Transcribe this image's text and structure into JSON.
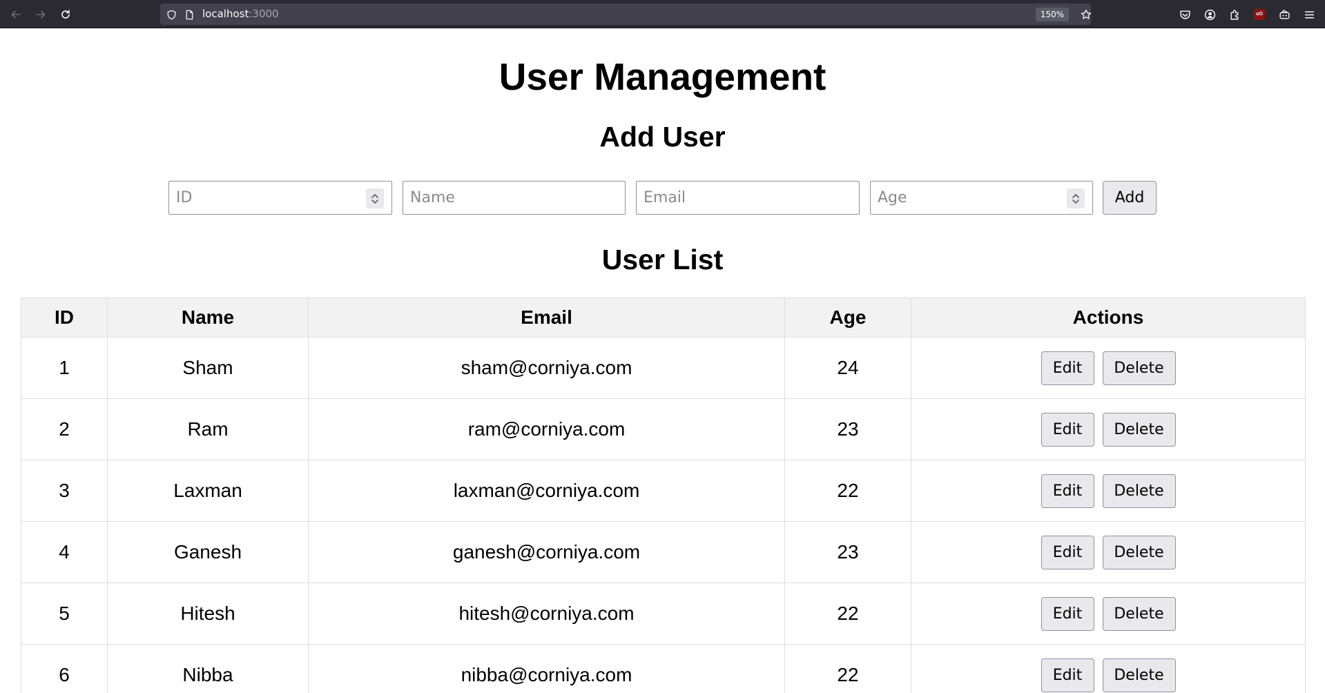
{
  "browser": {
    "url_host": "localhost",
    "url_port": ":3000",
    "zoom": "150%",
    "icons": {
      "back": "back-arrow-icon",
      "forward": "forward-arrow-icon",
      "reload": "reload-icon",
      "site_info": "shield-icon",
      "page": "page-icon",
      "bookmark": "star-icon",
      "pocket": "pocket-icon",
      "account": "account-icon",
      "extensions": "puzzle-icon",
      "ublock": "ublock-icon",
      "extension2": "extension-icon",
      "menu": "hamburger-menu-icon"
    },
    "ublock_label": "uO"
  },
  "page": {
    "title": "User Management",
    "add_section_title": "Add User",
    "list_section_title": "User List"
  },
  "form": {
    "id_placeholder": "ID",
    "name_placeholder": "Name",
    "email_placeholder": "Email",
    "age_placeholder": "Age",
    "add_label": "Add"
  },
  "table": {
    "headers": [
      "ID",
      "Name",
      "Email",
      "Age",
      "Actions"
    ],
    "rows": [
      {
        "id": "1",
        "name": "Sham",
        "email": "sham@corniya.com",
        "age": "24"
      },
      {
        "id": "2",
        "name": "Ram",
        "email": "ram@corniya.com",
        "age": "23"
      },
      {
        "id": "3",
        "name": "Laxman",
        "email": "laxman@corniya.com",
        "age": "22"
      },
      {
        "id": "4",
        "name": "Ganesh",
        "email": "ganesh@corniya.com",
        "age": "23"
      },
      {
        "id": "5",
        "name": "Hitesh",
        "email": "hitesh@corniya.com",
        "age": "22"
      },
      {
        "id": "6",
        "name": "Nibba",
        "email": "nibba@corniya.com",
        "age": "22"
      }
    ],
    "edit_label": "Edit",
    "delete_label": "Delete"
  },
  "colors": {
    "chrome_bg": "#2b2a33",
    "urlbar_bg": "#42414d",
    "button_bg": "#e9e9ed",
    "header_bg": "#f2f2f2",
    "border": "#dddddd"
  }
}
